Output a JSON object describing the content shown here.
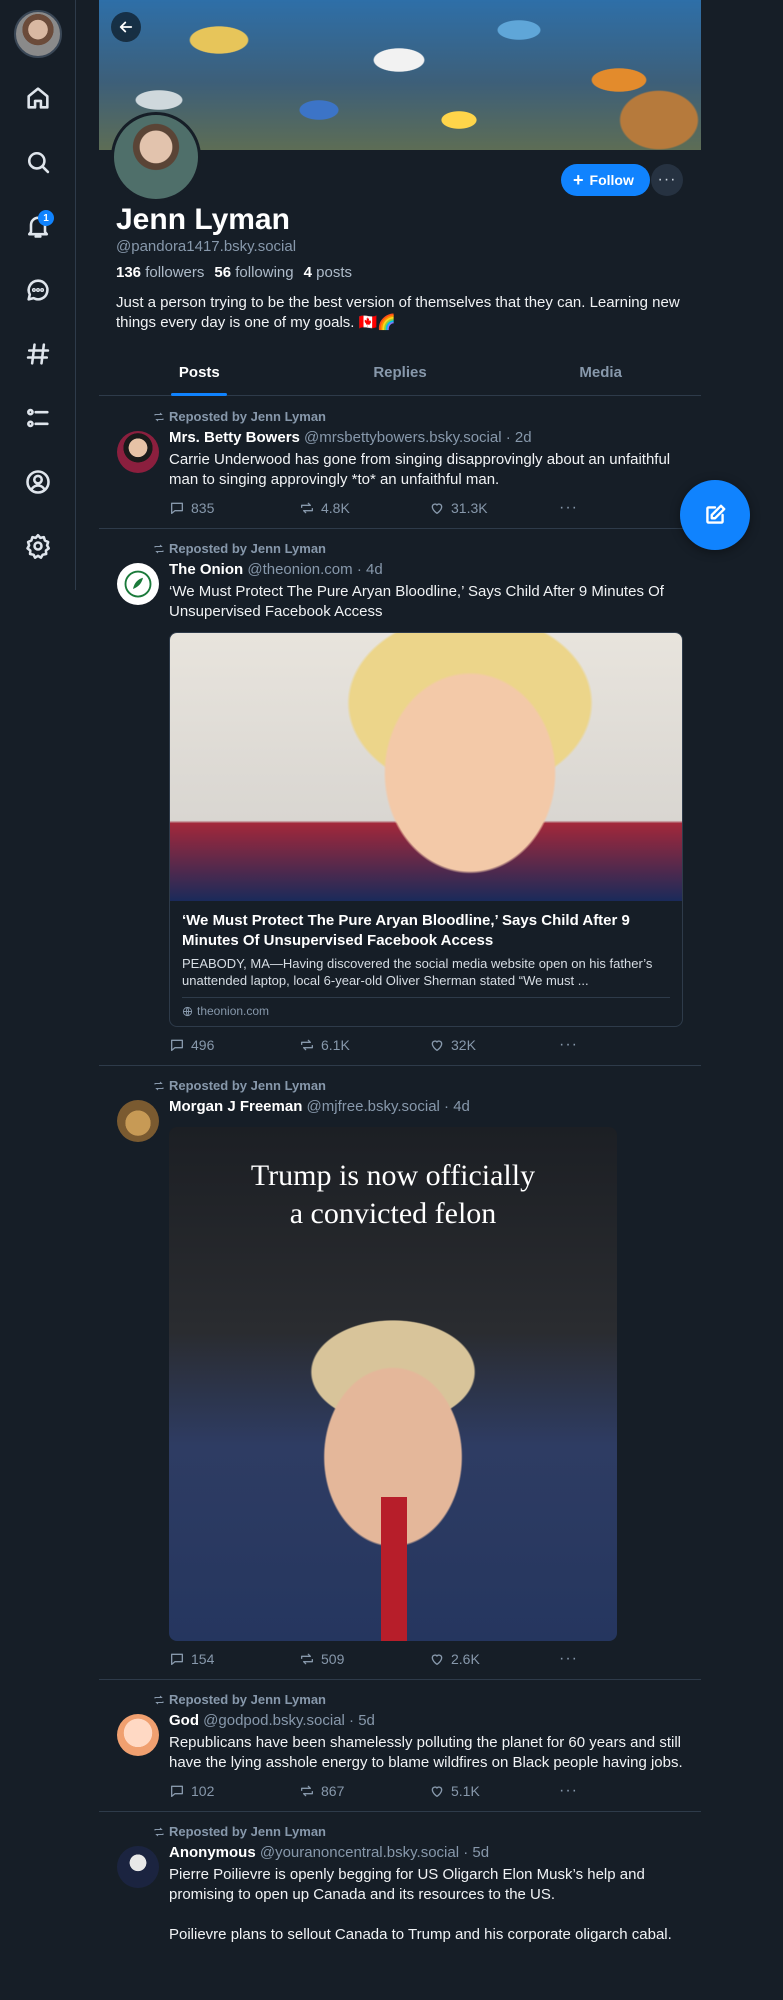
{
  "sidebar": {
    "notification_count": "1",
    "items": [
      {
        "icon": "home-icon"
      },
      {
        "icon": "search-icon"
      },
      {
        "icon": "bell-icon"
      },
      {
        "icon": "chat-icon"
      },
      {
        "icon": "hashtag-icon"
      },
      {
        "icon": "list-icon"
      },
      {
        "icon": "profile-icon"
      },
      {
        "icon": "gear-icon"
      }
    ]
  },
  "profile": {
    "name": "Jenn Lyman",
    "handle": "@pandora1417.bsky.social",
    "followers_count": "136",
    "followers_label": "followers",
    "following_count": "56",
    "following_label": "following",
    "posts_count": "4",
    "posts_label": "posts",
    "bio": "Just a person trying to be the best version of themselves that they can. Learning new things every day is one of my goals. 🇨🇦🌈",
    "follow_label": "Follow",
    "more_label": "···"
  },
  "tabs": [
    {
      "label": "Posts",
      "active": true
    },
    {
      "label": "Replies",
      "active": false
    },
    {
      "label": "Media",
      "active": false
    }
  ],
  "posts": [
    {
      "repost_label": "Reposted by Jenn Lyman",
      "display_name": "Mrs. Betty Bowers",
      "handle": "@mrsbettybowers.bsky.social",
      "time": "· 2d",
      "text": "Carrie Underwood has gone from singing disapprovingly about an unfaithful man to singing approvingly *to* an unfaithful man.",
      "replies": "835",
      "reposts": "4.8K",
      "likes": "31.3K"
    },
    {
      "repost_label": "Reposted by Jenn Lyman",
      "display_name": "The Onion",
      "handle": "@theonion.com",
      "time": "· 4d",
      "text": "‘We Must Protect The Pure Aryan Bloodline,’ Says Child After 9 Minutes Of Unsupervised Facebook Access",
      "card_title": "‘We Must Protect The Pure Aryan Bloodline,’ Says Child After 9 Minutes Of Unsupervised Facebook Access",
      "card_desc": "PEABODY, MA—Having discovered the social media website open on his father’s unattended laptop, local 6-year-old Oliver Sherman stated “We must ...",
      "card_domain": "theonion.com",
      "replies": "496",
      "reposts": "6.1K",
      "likes": "32K"
    },
    {
      "repost_label": "Reposted by Jenn Lyman",
      "display_name": "Morgan J Freeman",
      "handle": "@mjfree.bsky.social",
      "time": "· 4d",
      "text": "",
      "image_headline": "Trump is now officially\na convicted felon",
      "replies": "154",
      "reposts": "509",
      "likes": "2.6K"
    },
    {
      "repost_label": "Reposted by Jenn Lyman",
      "display_name": "God",
      "handle": "@godpod.bsky.social",
      "time": "· 5d",
      "text": "Republicans have been shamelessly polluting the planet for 60 years and still have the lying asshole energy to blame wildfires on Black people having jobs.",
      "replies": "102",
      "reposts": "867",
      "likes": "5.1K"
    },
    {
      "repost_label": "Reposted by Jenn Lyman",
      "display_name": "Anonymous",
      "handle": "@youranoncentral.bsky.social",
      "time": "· 5d",
      "text": "Pierre Poilievre is openly begging for US Oligarch Elon Musk’s help and promising to open up Canada and its resources to the US.\n\nPoilievre plans to sellout Canada to Trump and his corporate oligarch cabal."
    }
  ],
  "colors": {
    "background": "#161e27",
    "accent": "#1083fe",
    "muted_text": "#8798ab",
    "border": "#2e3b4a"
  }
}
